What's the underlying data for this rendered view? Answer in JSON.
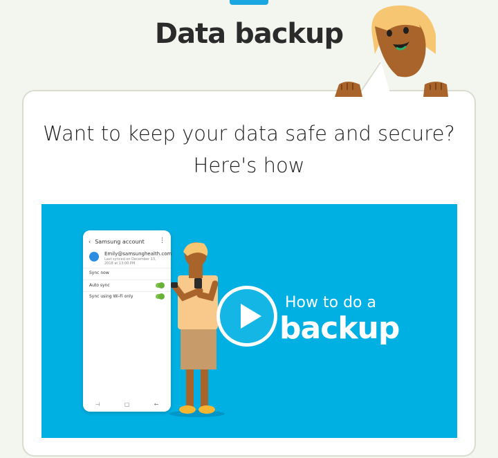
{
  "header": {
    "title": "Data backup"
  },
  "card": {
    "subtitle_line1": "Want to keep your data safe and secure?",
    "subtitle_line2": "Here's how"
  },
  "video": {
    "caption_line1": "How to do a",
    "caption_line2": "backup",
    "phone": {
      "title": "Samsung account",
      "email": "Emily@samsunghealth.com",
      "last_synced": "Last synced on December 13, 2018 at 13:00 PM",
      "rows": [
        {
          "label": "Sync now",
          "toggle": false
        },
        {
          "label": "Auto sync",
          "toggle": true
        },
        {
          "label": "Sync using Wi-Fi only",
          "toggle": true
        }
      ]
    }
  },
  "colors": {
    "accent": "#1aa6df",
    "video_bg": "#00b0e3",
    "toggle_on": "#7ec24b",
    "page_bg": "#f3f5ef"
  },
  "icons": {
    "play": "play-icon",
    "back": "back-arrow-icon",
    "menu": "more-vertical-icon",
    "account": "account-icon"
  }
}
